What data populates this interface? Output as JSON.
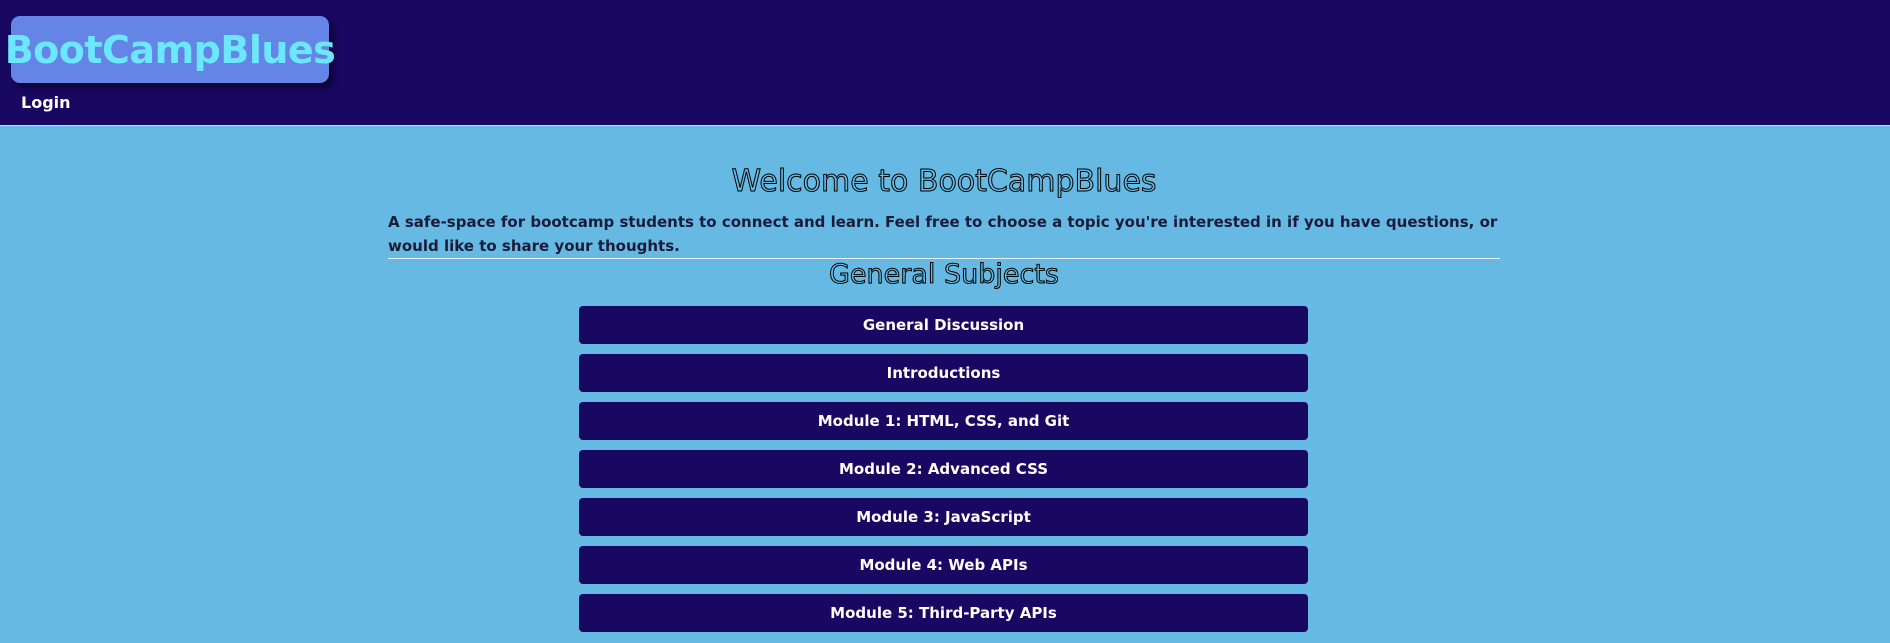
{
  "header": {
    "logo_text": "BootCampBlues",
    "login_label": "Login"
  },
  "main": {
    "title": "Welcome to BootCampBlues",
    "intro": "A safe-space for bootcamp students to connect and learn. Feel free to choose a topic you're interested in if you have questions, or would like to share your thoughts.",
    "subjects_title": "General Subjects",
    "topics": [
      {
        "label": "General Discussion"
      },
      {
        "label": "Introductions"
      },
      {
        "label": "Module 1: HTML, CSS, and Git"
      },
      {
        "label": "Module 2: Advanced CSS"
      },
      {
        "label": "Module 3: JavaScript"
      },
      {
        "label": "Module 4: Web APIs"
      },
      {
        "label": "Module 5: Third-Party APIs"
      }
    ]
  },
  "colors": {
    "header_bg": "#180861",
    "page_bg": "#66b9e2",
    "logo_bg": "#6585e6",
    "logo_text": "#6be7ff",
    "button_bg": "#180861",
    "button_text": "#ffffff"
  }
}
